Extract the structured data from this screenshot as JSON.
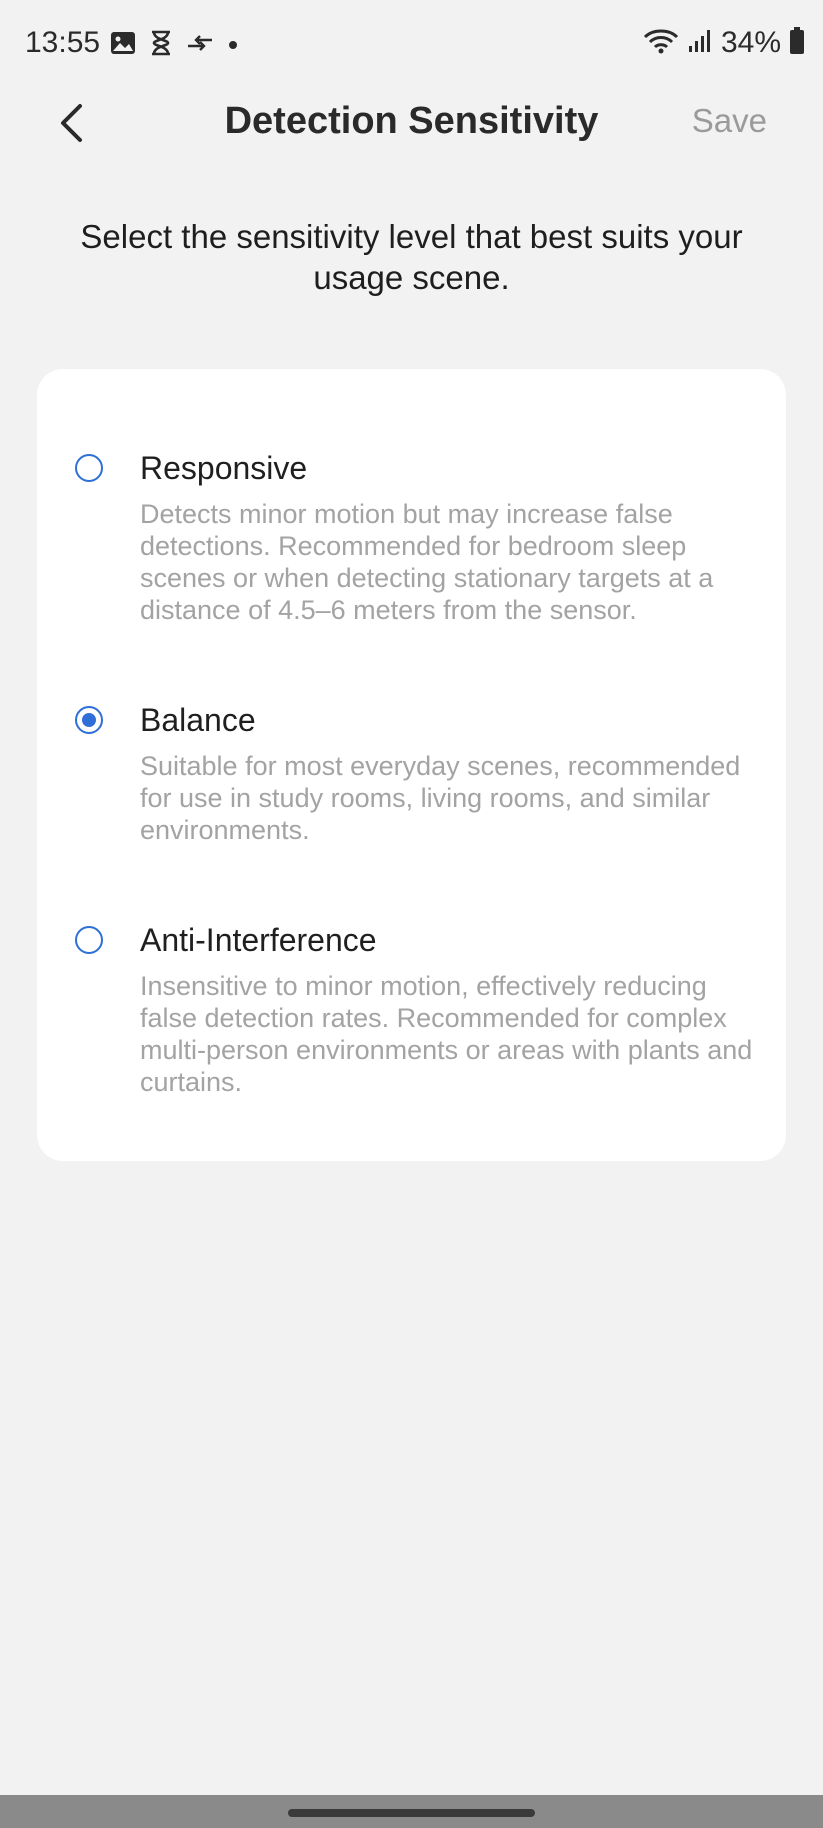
{
  "status_bar": {
    "time": "13:55",
    "battery_percent": "34%",
    "left_icons": [
      "image-icon",
      "hourglass-icon",
      "data-transfer-icon",
      "dot-icon"
    ],
    "right_icons": [
      "wifi-icon",
      "signal-icon",
      "battery-icon"
    ]
  },
  "header": {
    "title": "Detection Sensitivity",
    "save_label": "Save",
    "back_icon": "chevron-left-icon"
  },
  "instructions": "Select the sensitivity level that best suits your usage scene.",
  "options": [
    {
      "title": "Responsive",
      "description": "Detects minor motion but may increase false detections. Recommended for bedroom sleep scenes or when detecting stationary targets at a distance of 4.5–6 meters from the sensor.",
      "selected": false
    },
    {
      "title": "Balance",
      "description": "Suitable for most everyday scenes, recommended for use in study rooms, living rooms, and similar environments.",
      "selected": true
    },
    {
      "title": "Anti-Interference",
      "description": "Insensitive to minor motion, effectively reducing false detection rates. Recommended for complex multi-person environments or areas with plants and curtains.",
      "selected": false
    }
  ],
  "colors": {
    "accent": "#2f6fd6",
    "background": "#f2f2f2",
    "card": "#ffffff",
    "muted_text": "#a3a3a3"
  }
}
